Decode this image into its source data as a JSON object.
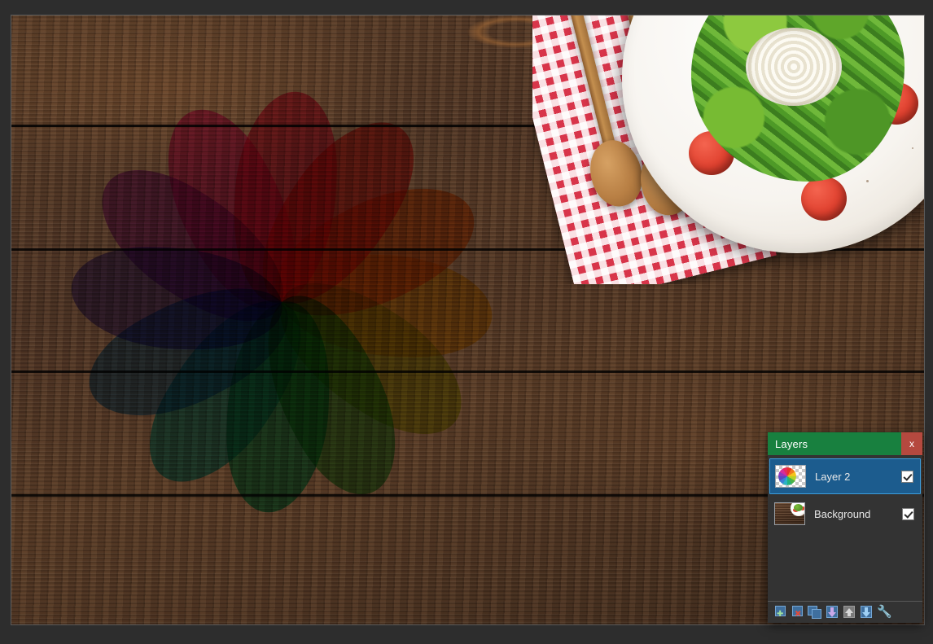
{
  "app": {
    "canvas_image_description": "Top-down photo of arugula salad with cherry tomatoes and mozzarella on a white plate, wooden spoons on a red gingham napkin, rustic dark-wood plank table",
    "overlay_description": "Twelve-petal rainbow colour-wheel pinwheel composited over the wood planks"
  },
  "panel": {
    "title": "Layers",
    "close_label": "x",
    "close_icon": "close-icon",
    "titlebar_color": "#18803f",
    "close_button_color": "#b5493f",
    "selection_color": "#1c5c8e",
    "selection_border_color": "#3d9ddb",
    "background_color": "#333333"
  },
  "layers": [
    {
      "name": "Layer 2",
      "visible": true,
      "selected": true,
      "thumbnail": "color-wheel-on-transparent-checkerboard"
    },
    {
      "name": "Background",
      "visible": false,
      "selected": false,
      "thumbnail": "wood-table-with-salad-plate"
    }
  ],
  "toolbar": [
    {
      "name": "add-layer",
      "icon": "layer-plus-icon",
      "tooltip": "Add new layer"
    },
    {
      "name": "delete-layer",
      "icon": "layer-delete-icon",
      "tooltip": "Delete layer"
    },
    {
      "name": "duplicate-layer",
      "icon": "layer-duplicate-icon",
      "tooltip": "Duplicate layer"
    },
    {
      "name": "merge-layer-down",
      "icon": "layer-merge-down-icon",
      "tooltip": "Merge layer down"
    },
    {
      "name": "move-layer-up",
      "icon": "layer-move-up-icon",
      "tooltip": "Move layer up"
    },
    {
      "name": "move-layer-down",
      "icon": "layer-move-down-icon",
      "tooltip": "Move layer down"
    },
    {
      "name": "layer-properties",
      "icon": "wrench-icon",
      "tooltip": "Layer properties"
    }
  ],
  "pinwheel_colors": [
    "#e8322a",
    "#f07b1e",
    "#f3c41a",
    "#b7d326",
    "#49b348",
    "#22b27c",
    "#2bb3c4",
    "#3b7fd4",
    "#5b46c0",
    "#9236bb",
    "#d62d9b",
    "#e62b5a"
  ]
}
